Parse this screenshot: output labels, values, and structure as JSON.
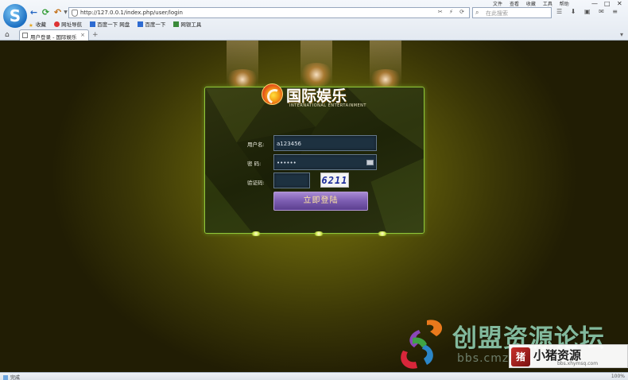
{
  "browser": {
    "url": "http://127.0.0.1/index.php/user/login",
    "search_placeholder": "在此搜索",
    "top_menu": [
      "文件",
      "查看",
      "收藏",
      "工具",
      "帮助"
    ],
    "bookmarks": [
      "收藏",
      "网址导航",
      "百度一下 网盘",
      "百度一下",
      "网银工具"
    ],
    "tab_title": "用户登录 - 国际娱乐",
    "status_text": "完成",
    "status_right": "100%"
  },
  "login": {
    "brand_cn": "国际娱乐",
    "brand_en": "INTERNATIONAL ENTERTAINMENT",
    "username_label": "用户名:",
    "username_value": "a123456",
    "password_label": "密 码:",
    "password_value": "••••••",
    "captcha_label": "验证码:",
    "captcha_value": "",
    "captcha_image_text": "6211",
    "submit_label": "立即登陆"
  },
  "watermark": {
    "cn": "创盟资源论坛",
    "url": "bbs.cmzy.cn",
    "badge_name": "小猪资源",
    "badge_url": "bbs.xhymsq.com"
  },
  "colors": {
    "panel_border": "#8fc73a",
    "button_top": "#a88ad4",
    "button_bottom": "#5c3f90",
    "field_bg": "#1d3140"
  }
}
